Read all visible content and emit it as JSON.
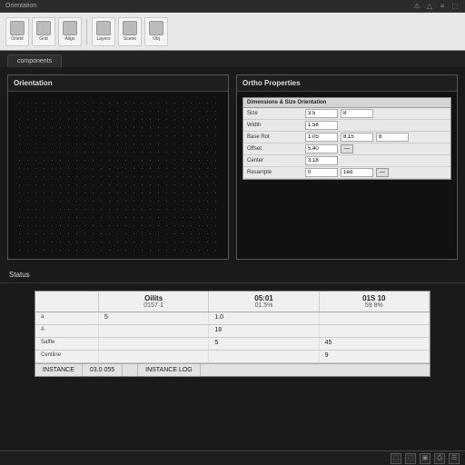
{
  "app": {
    "title": "Orientation"
  },
  "topIndicators": [
    "⚠",
    "△",
    "≡",
    "⬚"
  ],
  "ribbon": [
    {
      "label": "Orient"
    },
    {
      "label": "Grid"
    },
    {
      "label": "Align"
    },
    {
      "label": "Layers"
    },
    {
      "label": "Scene"
    },
    {
      "label": "Obj"
    }
  ],
  "tabs": {
    "active": "components"
  },
  "panels": {
    "left": {
      "title": "Orientation"
    },
    "right": {
      "title": "Ortho Properties",
      "cardHeader": "Dimensions & Size Orientation",
      "rows": [
        {
          "k": "Size",
          "v": [
            "3.5",
            "8"
          ]
        },
        {
          "k": "Width",
          "v": [
            "1.58"
          ]
        },
        {
          "k": "Base Rot",
          "v": [
            "1.05",
            "8.15",
            "8"
          ]
        },
        {
          "k": "Offset",
          "v": [
            "5.40",
            "—"
          ]
        },
        {
          "k": "Center",
          "v": [
            "3.18"
          ]
        },
        {
          "k": "Resample",
          "v": [
            "0",
            "1ed",
            "—"
          ]
        }
      ]
    }
  },
  "lower": {
    "title": "Status",
    "columns": [
      {
        "c1": "Oilits",
        "c2": "0157·1"
      },
      {
        "c1": "05:01",
        "c2": "01.5%"
      },
      {
        "c1": "01S 10",
        "c2": "59 8%"
      }
    ],
    "rows": [
      {
        "k": "a",
        "v": [
          "5",
          "1.0",
          ""
        ]
      },
      {
        "k": "A",
        "v": [
          "",
          "18",
          ""
        ]
      },
      {
        "k": "Saffle",
        "v": [
          "",
          "5",
          "45"
        ]
      },
      {
        "k": "Centline",
        "v": [
          "",
          "",
          "9"
        ]
      }
    ],
    "footer": [
      "INSTANCE",
      "03.0 055",
      "",
      "INSTANCE LOG"
    ]
  },
  "status": [
    "⬚",
    "⬚",
    "▣",
    "⎙",
    "☰"
  ]
}
